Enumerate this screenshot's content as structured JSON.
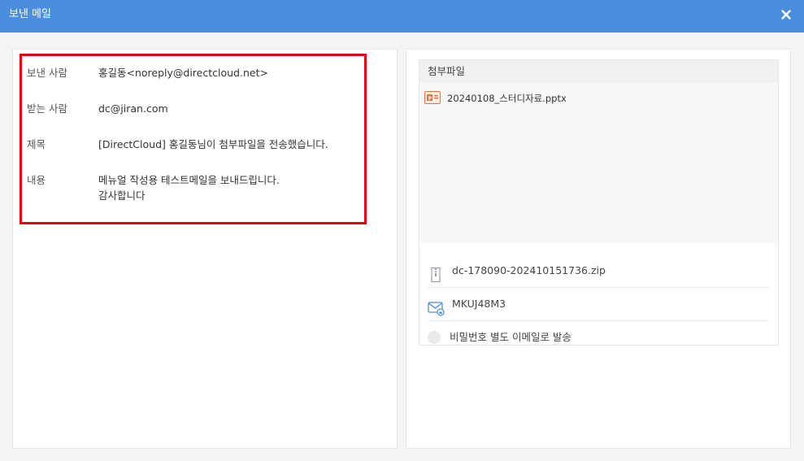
{
  "window": {
    "title": "보낸 메일"
  },
  "mail": {
    "sender_label": "보낸 사람",
    "sender_value": "홍길동<noreply@directcloud.net>",
    "recipient_label": "받는 사람",
    "recipient_value": "dc@jiran.com",
    "subject_label": "제목",
    "subject_value": "[DirectCloud] 홍길동님이 첨부파일을 전송했습니다.",
    "body_label": "내용",
    "body_line1": "메뉴얼 작성용 테스트메일을 보내드립니다.",
    "body_line2": "감사합니다"
  },
  "attachments": {
    "header": "첨부파일",
    "files": [
      {
        "name": "20240108_스터디자료.pptx",
        "icon": "pptx-file-icon"
      }
    ],
    "archive_name": "dc-178090-202410151736.zip",
    "password": "MKUJ48M3",
    "send_password_option": "비밀번호 별도 이메일로 발송"
  },
  "colors": {
    "titlebar": "#4a8fdd",
    "highlight": "#e60012",
    "pptx_icon": "#e8703a",
    "mail_icon": "#4a8fdd"
  }
}
